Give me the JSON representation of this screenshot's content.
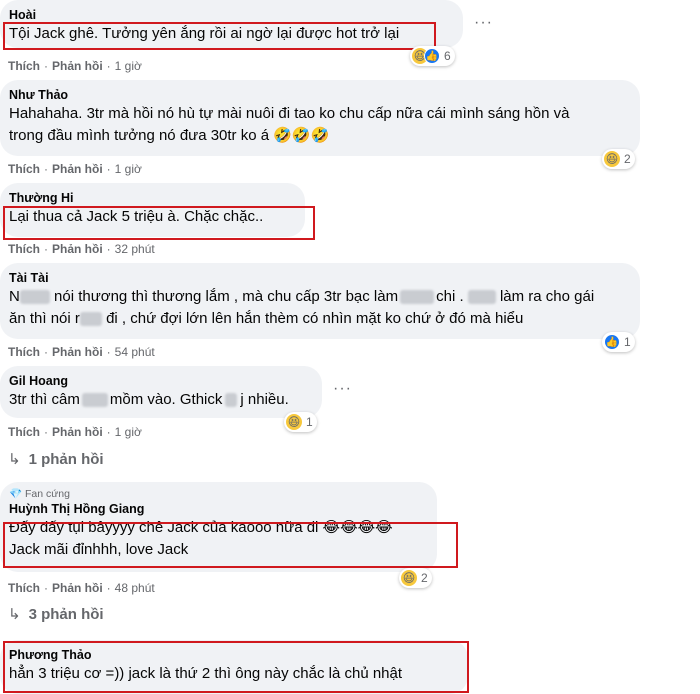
{
  "comments": [
    {
      "name": "Hoài",
      "lines": [
        "Tội Jack ghê. Tưởng yên ắng rồi ai ngờ lại được hot trở lại"
      ],
      "like": "Thích",
      "reply": "Phản hồi",
      "time": "1 giờ",
      "reaction_count": "6",
      "reactions": [
        "haha-icon",
        "like-icon"
      ]
    },
    {
      "name": "Như Thảo",
      "lines": [
        "Hahahaha. 3tr mà hồi nó hù tự mài nuôi đi tao ko chu cấp nữa cái mình sáng hồn và",
        "trong đầu mình tưởng nó đưa 30tr ko á 🤣🤣🤣"
      ],
      "like": "Thích",
      "reply": "Phản hồi",
      "time": "1 giờ",
      "reaction_count": "2",
      "reactions": [
        "haha-icon"
      ]
    },
    {
      "name": "Thường Hi",
      "lines": [
        "Lại thua cả Jack 5 triệu à. Chặc chặc.."
      ],
      "like": "Thích",
      "reply": "Phản hồi",
      "time": "32 phút"
    },
    {
      "name": "Tài Tài",
      "lines_a": [
        "N",
        "nói thương thì thương lắm , mà chu cấp 3tr bạc làm",
        "chi .",
        "làm ra cho gái"
      ],
      "lines_b": [
        "ăn thì nói r",
        "đi , chứ đợi lớn lên hắn thèm có nhìn mặt ko chứ ở đó mà hiểu"
      ],
      "like": "Thích",
      "reply": "Phản hồi",
      "time": "54 phút",
      "reaction_count": "1",
      "reactions": [
        "like-icon"
      ]
    },
    {
      "name": "Gil Hoang",
      "text_a": "3tr thì câm",
      "text_b": "mồm vào. Gthick",
      "text_c": "j nhiều.",
      "like": "Thích",
      "reply": "Phản hồi",
      "time": "1 giờ",
      "reaction_count": "1",
      "reactions": [
        "haha-icon"
      ],
      "replies": "1 phản hồi"
    },
    {
      "badge": "Fan cứng",
      "name": "Huỳnh Thị Hồng Giang",
      "lines": [
        "Đấy đấy tụi bâyyyy chê Jack của kaooo nữa đi 😂😂😂😂",
        "Jack mãi đỉnhhh, love Jack"
      ],
      "like": "Thích",
      "reply": "Phản hồi",
      "time": "48 phút",
      "reaction_count": "2",
      "reactions": [
        "haha-icon"
      ],
      "replies": "3 phản hồi"
    },
    {
      "name": "Phương Thảo",
      "lines": [
        "hẳn 3 triệu cơ =)) jack là thứ 2 thì ông này chắc là chủ nhật"
      ]
    }
  ],
  "more_label": "···",
  "colors": {
    "highlight": "#d0191e",
    "bubble": "#f0f2f5",
    "muted": "#65676b",
    "like": "#1877f2",
    "haha": "#f7c83c"
  }
}
